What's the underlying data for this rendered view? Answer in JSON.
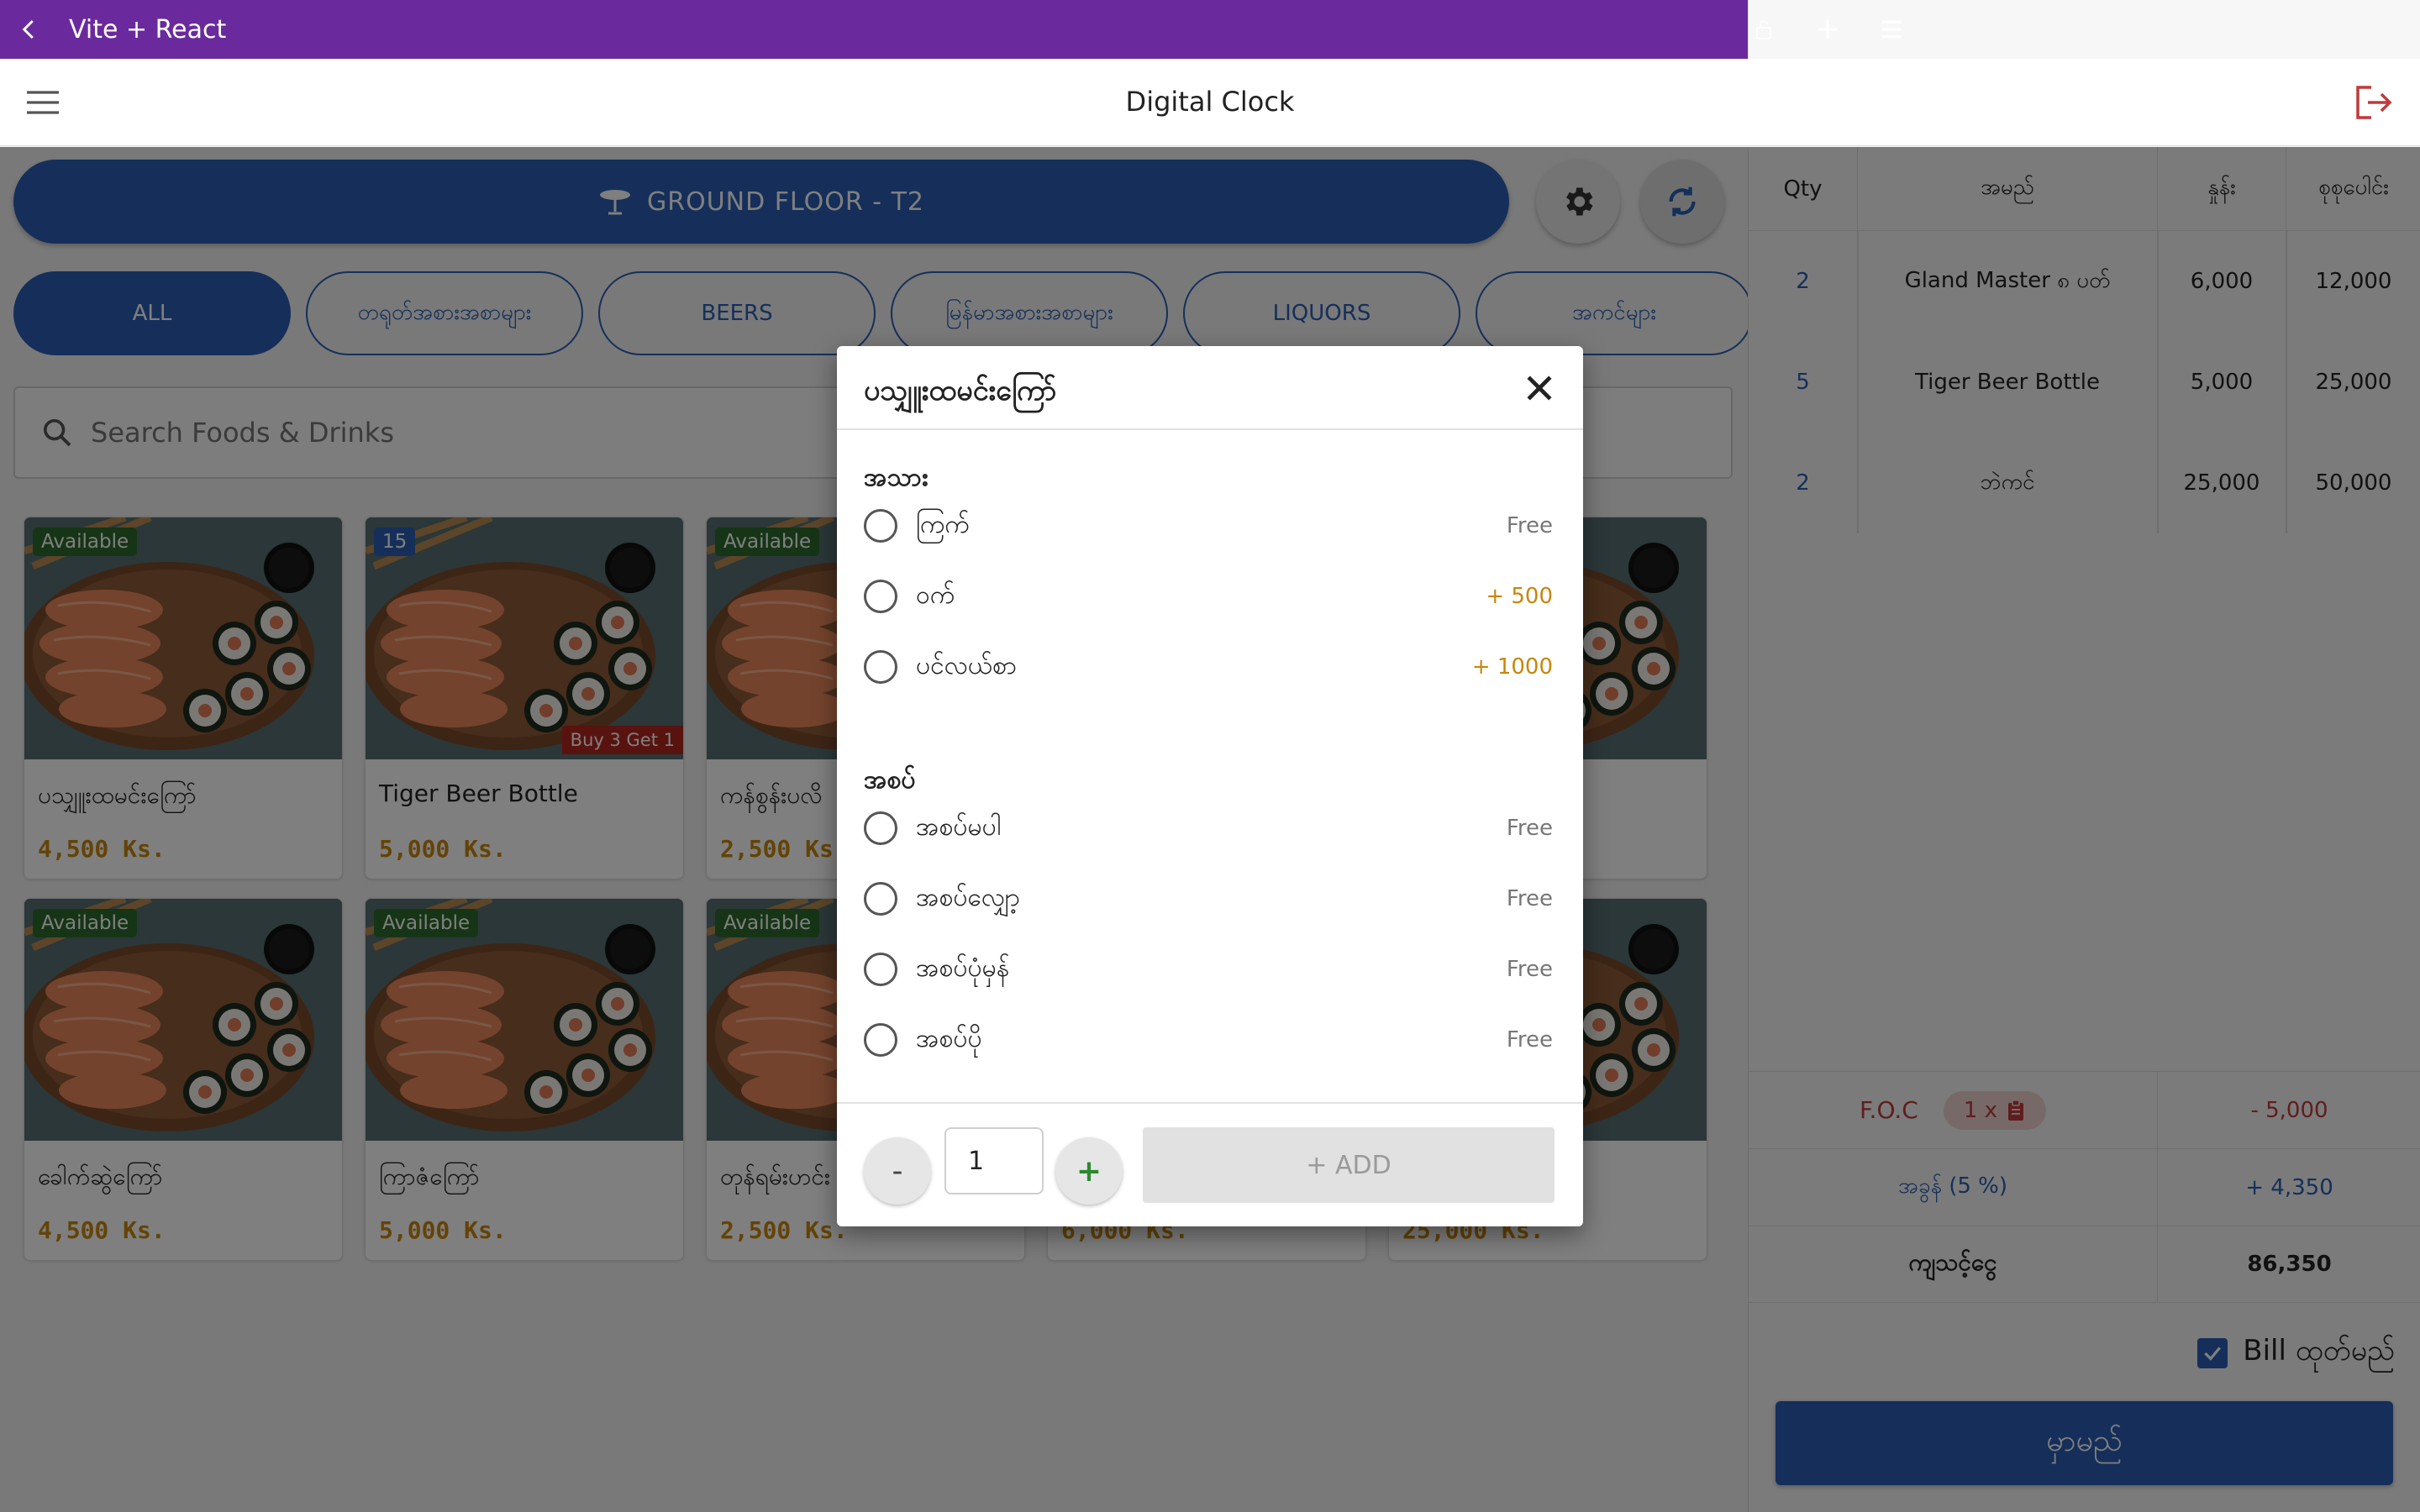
{
  "appbar": {
    "title": "Vite + React"
  },
  "header": {
    "title": "Digital Clock"
  },
  "table": {
    "label": "GROUND FLOOR - T2"
  },
  "categories": [
    {
      "label": "ALL"
    },
    {
      "label": "တရုတ်အစားအစာများ"
    },
    {
      "label": "BEERS"
    },
    {
      "label": "မြန်မာအစားအစာများ"
    },
    {
      "label": "LIQUORS"
    },
    {
      "label": "အကင်များ"
    }
  ],
  "search": {
    "placeholder": "Search Foods & Drinks"
  },
  "products": [
    {
      "badge": "Available",
      "name": "ပသျှူးထမင်းကြော်",
      "price": "4,500 Ks."
    },
    {
      "badge": "15",
      "promo": "Buy 3 Get 1",
      "name": "Tiger Beer Bottle",
      "price": "5,000 Ks."
    },
    {
      "badge": "Available",
      "name": "ကန်စွန်းပလိ",
      "price": "2,500 Ks."
    },
    {
      "badge": "",
      "name": "",
      "price": ""
    },
    {
      "badge": "",
      "name": "",
      "price": ""
    },
    {
      "badge": "Available",
      "name": "ခေါက်ဆွဲကြော်",
      "price": "4,500 Ks."
    },
    {
      "badge": "Available",
      "name": "ကြာဇံကြော်",
      "price": "5,000 Ks."
    },
    {
      "badge": "Available",
      "name": "တုန်ရမ်းဟင်း",
      "price": "2,500 Ks."
    },
    {
      "badge": "",
      "name": "",
      "price": "6,000 Ks."
    },
    {
      "badge": "",
      "name": "",
      "price": "25,000 Ks."
    }
  ],
  "order": {
    "headers": {
      "qty": "Qty",
      "name": "အမည်",
      "price": "နှုန်း",
      "total": "စုစုပေါင်း"
    },
    "rows": [
      {
        "qty": "2",
        "name": "Gland Master ၈ ပတ်",
        "price": "6,000",
        "total": "12,000"
      },
      {
        "qty": "5",
        "name": "Tiger Beer Bottle",
        "price": "5,000",
        "total": "25,000"
      },
      {
        "qty": "2",
        "name": "ဘဲကင်",
        "price": "25,000",
        "total": "50,000"
      }
    ],
    "foc": {
      "label": "F.O.C",
      "chip": "1 x",
      "value": "- 5,000"
    },
    "tax": {
      "label": "အခွန် (5 %)",
      "value": "+ 4,350"
    },
    "total": {
      "label": "ကျသင့်ငွေ",
      "value": "86,350"
    },
    "bill_label": "Bill ထုတ်မည်",
    "order_button": "မှာမည်"
  },
  "modal": {
    "title": "ပသျှူးထမင်းကြော်",
    "groups": [
      {
        "title": "အသား",
        "options": [
          {
            "label": "ကြက်",
            "price": "Free"
          },
          {
            "label": "ဝက်",
            "price": "+ 500"
          },
          {
            "label": "ပင်လယ်စာ",
            "price": "+ 1000"
          }
        ]
      },
      {
        "title": "အစပ်",
        "options": [
          {
            "label": "အစပ်မပါ",
            "price": "Free"
          },
          {
            "label": "အစပ်လျှော့",
            "price": "Free"
          },
          {
            "label": "အစပ်ပုံမှန်",
            "price": "Free"
          },
          {
            "label": "အစပ်ပို",
            "price": "Free"
          }
        ]
      }
    ],
    "quantity": "1",
    "minus": "-",
    "plus": "+",
    "add_label": "+ ADD"
  },
  "colors": {
    "appbar": "#6a2a9e",
    "primary": "#2a5fb4",
    "available": "#2c6a2c",
    "price": "#c8860e",
    "promo": "#b3261e",
    "foc": "#c03a3a"
  }
}
